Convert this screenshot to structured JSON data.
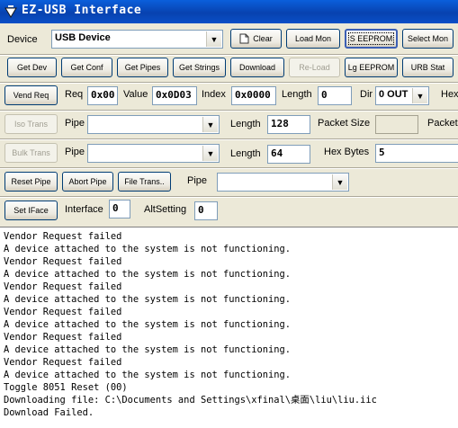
{
  "window": {
    "title": "EZ-USB Interface",
    "icon": "app-icon"
  },
  "row1": {
    "device_label": "Device",
    "device_value": "USB Device",
    "clear_label": "Clear",
    "clear_icon": "document-icon",
    "load_mon": "Load Mon",
    "s_eeprom": "S EEPROM",
    "select_mon": "Select Mon"
  },
  "row2": {
    "get_dev": "Get Dev",
    "get_conf": "Get Conf",
    "get_pipes": "Get Pipes",
    "get_strings": "Get Strings",
    "download": "Download",
    "re_load": "Re-Load",
    "lg_eeprom": "Lg EEPROM",
    "urb_stat": "URB Stat"
  },
  "row3": {
    "vend_req": "Vend Req",
    "req_label": "Req",
    "req_value": "0x00",
    "value_label": "Value",
    "value_value": "0x0D03",
    "index_label": "Index",
    "index_value": "0x0000",
    "length_label": "Length",
    "length_value": "0",
    "dir_label": "Dir",
    "dir_value": "0 OUT",
    "hex_label": "Hex"
  },
  "row4": {
    "iso_trans": "Iso Trans",
    "pipe_label": "Pipe",
    "length_label": "Length",
    "length_value": "128",
    "packet_size_label": "Packet Size",
    "packet_label": "Packet"
  },
  "row5": {
    "bulk_trans": "Bulk Trans",
    "pipe_label": "Pipe",
    "length_label": "Length",
    "length_value": "64",
    "hex_bytes_label": "Hex Bytes",
    "hex_bytes_value": "5"
  },
  "row6": {
    "reset_pipe": "Reset Pipe",
    "abort_pipe": "Abort Pipe",
    "file_trans": "File Trans..",
    "pipe_label": "Pipe"
  },
  "row7": {
    "set_iface": "Set IFace",
    "interface_label": "Interface",
    "interface_value": "0",
    "altsetting_label": "AltSetting",
    "altsetting_value": "0"
  },
  "log_lines": [
    "Vendor Request failed",
    "A device attached to the system is not functioning.",
    "Vendor Request failed",
    "A device attached to the system is not functioning.",
    "Vendor Request failed",
    "A device attached to the system is not functioning.",
    "Vendor Request failed",
    "A device attached to the system is not functioning.",
    "Vendor Request failed",
    "A device attached to the system is not functioning.",
    "Vendor Request failed",
    "A device attached to the system is not functioning.",
    "Toggle 8051 Reset (00)",
    "Downloading file: C:\\Documents and Settings\\xfinal\\桌面\\liu\\liu.iic",
    "Download Failed."
  ]
}
